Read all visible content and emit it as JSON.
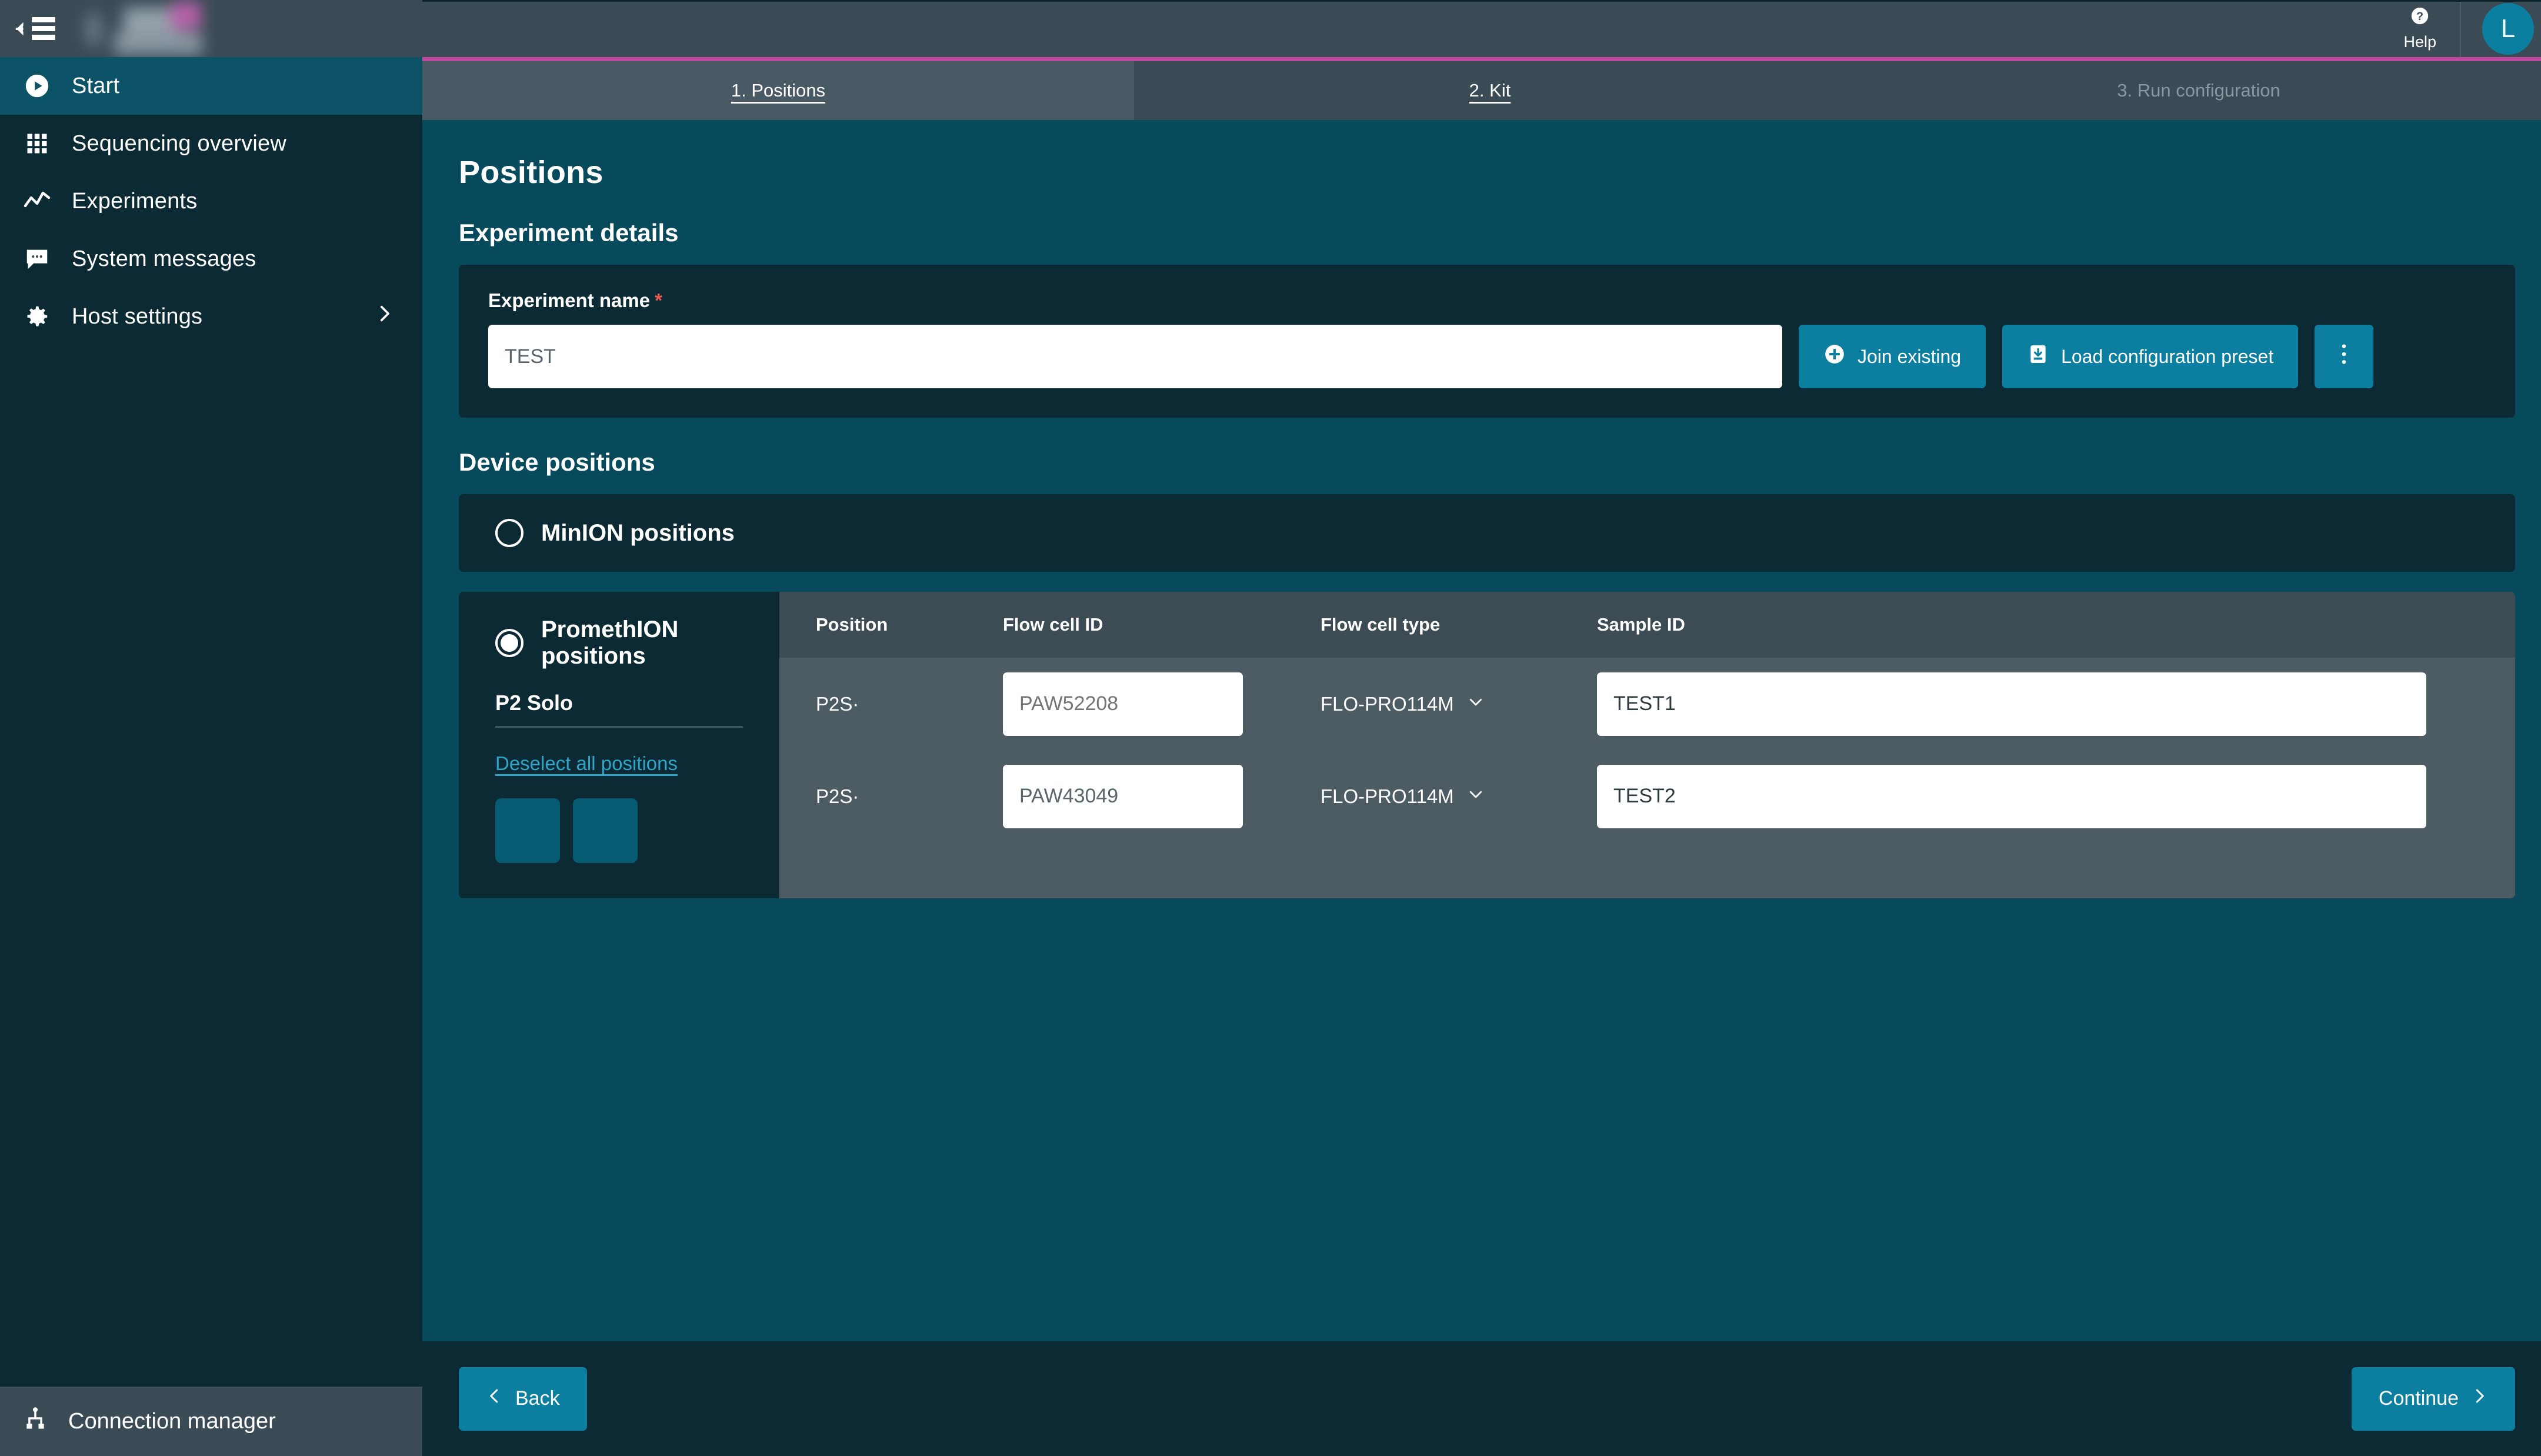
{
  "sidebar": {
    "collapse_icon": "collapse-menu-icon",
    "items": [
      {
        "label": "Start",
        "icon": "play-circle-icon",
        "active": true
      },
      {
        "label": "Sequencing overview",
        "icon": "grid-icon",
        "active": false
      },
      {
        "label": "Experiments",
        "icon": "line-chart-icon",
        "active": false
      },
      {
        "label": "System messages",
        "icon": "chat-bubble-icon",
        "active": false
      },
      {
        "label": "Host settings",
        "icon": "gear-icon",
        "active": false,
        "chevron": "chevron-right-icon"
      }
    ],
    "footer": {
      "label": "Connection manager",
      "icon": "network-node-icon"
    }
  },
  "topbar": {
    "help_label": "Help",
    "help_icon": "question-circle-icon",
    "avatar_initial": "L"
  },
  "steps": [
    {
      "label": "1. Positions",
      "state": "active"
    },
    {
      "label": "2. Kit",
      "state": "available"
    },
    {
      "label": "3. Run configuration",
      "state": "disabled"
    }
  ],
  "page": {
    "title": "Positions",
    "experiment_details_title": "Experiment details",
    "device_positions_title": "Device positions"
  },
  "experiment": {
    "name_label": "Experiment name",
    "required_marker": "*",
    "name_value": "TEST",
    "name_placeholder": "Experiment name",
    "join_existing_label": "Join existing",
    "join_existing_icon": "plus-circle-icon",
    "load_preset_label": "Load configuration preset",
    "load_preset_icon": "download-box-icon",
    "more_menu_icon": "kebab-menu-icon"
  },
  "device_positions": {
    "minion": {
      "label": "MinION positions",
      "selected": false
    },
    "promethion": {
      "label": "PromethION positions",
      "selected": true,
      "device_group_label": "P2 Solo",
      "deselect_link": "Deselect all positions",
      "tiles": [
        {
          "name": "position-tile-1",
          "selected": true
        },
        {
          "name": "position-tile-2",
          "selected": true
        }
      ],
      "table": {
        "headers": [
          "Position",
          "Flow cell ID",
          "Flow cell type",
          "Sample ID"
        ],
        "rows": [
          {
            "position": "P2S·",
            "flow_cell_id": "PAW52208",
            "flow_cell_id_is_placeholder": true,
            "flow_cell_type": "FLO-PRO114M",
            "sample_id": "TEST1"
          },
          {
            "position": "P2S·",
            "flow_cell_id": "PAW43049",
            "flow_cell_id_is_placeholder": false,
            "flow_cell_type": "FLO-PRO114M",
            "sample_id": "TEST2"
          }
        ]
      }
    }
  },
  "footer": {
    "back_label": "Back",
    "back_icon": "chevron-left-icon",
    "continue_label": "Continue",
    "continue_icon": "chevron-right-icon"
  },
  "colors": {
    "accent": "#0c7fa0",
    "brand_magenta": "#c2479f",
    "main_bg": "#074a5c",
    "panel_bg": "#0c2a33",
    "table_row_bg": "#4d5b63",
    "link": "#31a4c8",
    "required": "#f05a4f"
  }
}
